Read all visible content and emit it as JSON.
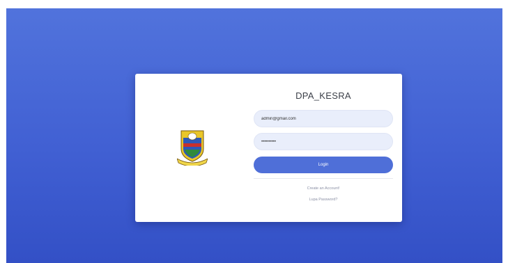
{
  "app": {
    "title": "DPA_KESRA"
  },
  "form": {
    "email_value": "admin@gmail.com",
    "password_value": "password12",
    "login_label": "Login"
  },
  "links": {
    "create_account": "Create an Account!",
    "forgot_password": "Lupa Password?"
  },
  "logo": {
    "icon": "crest-emblem-icon"
  },
  "colors": {
    "background_top": "#5173dc",
    "background_bottom": "#3350c6",
    "button": "#4f6fd8",
    "input_bg": "#e9eefb"
  }
}
